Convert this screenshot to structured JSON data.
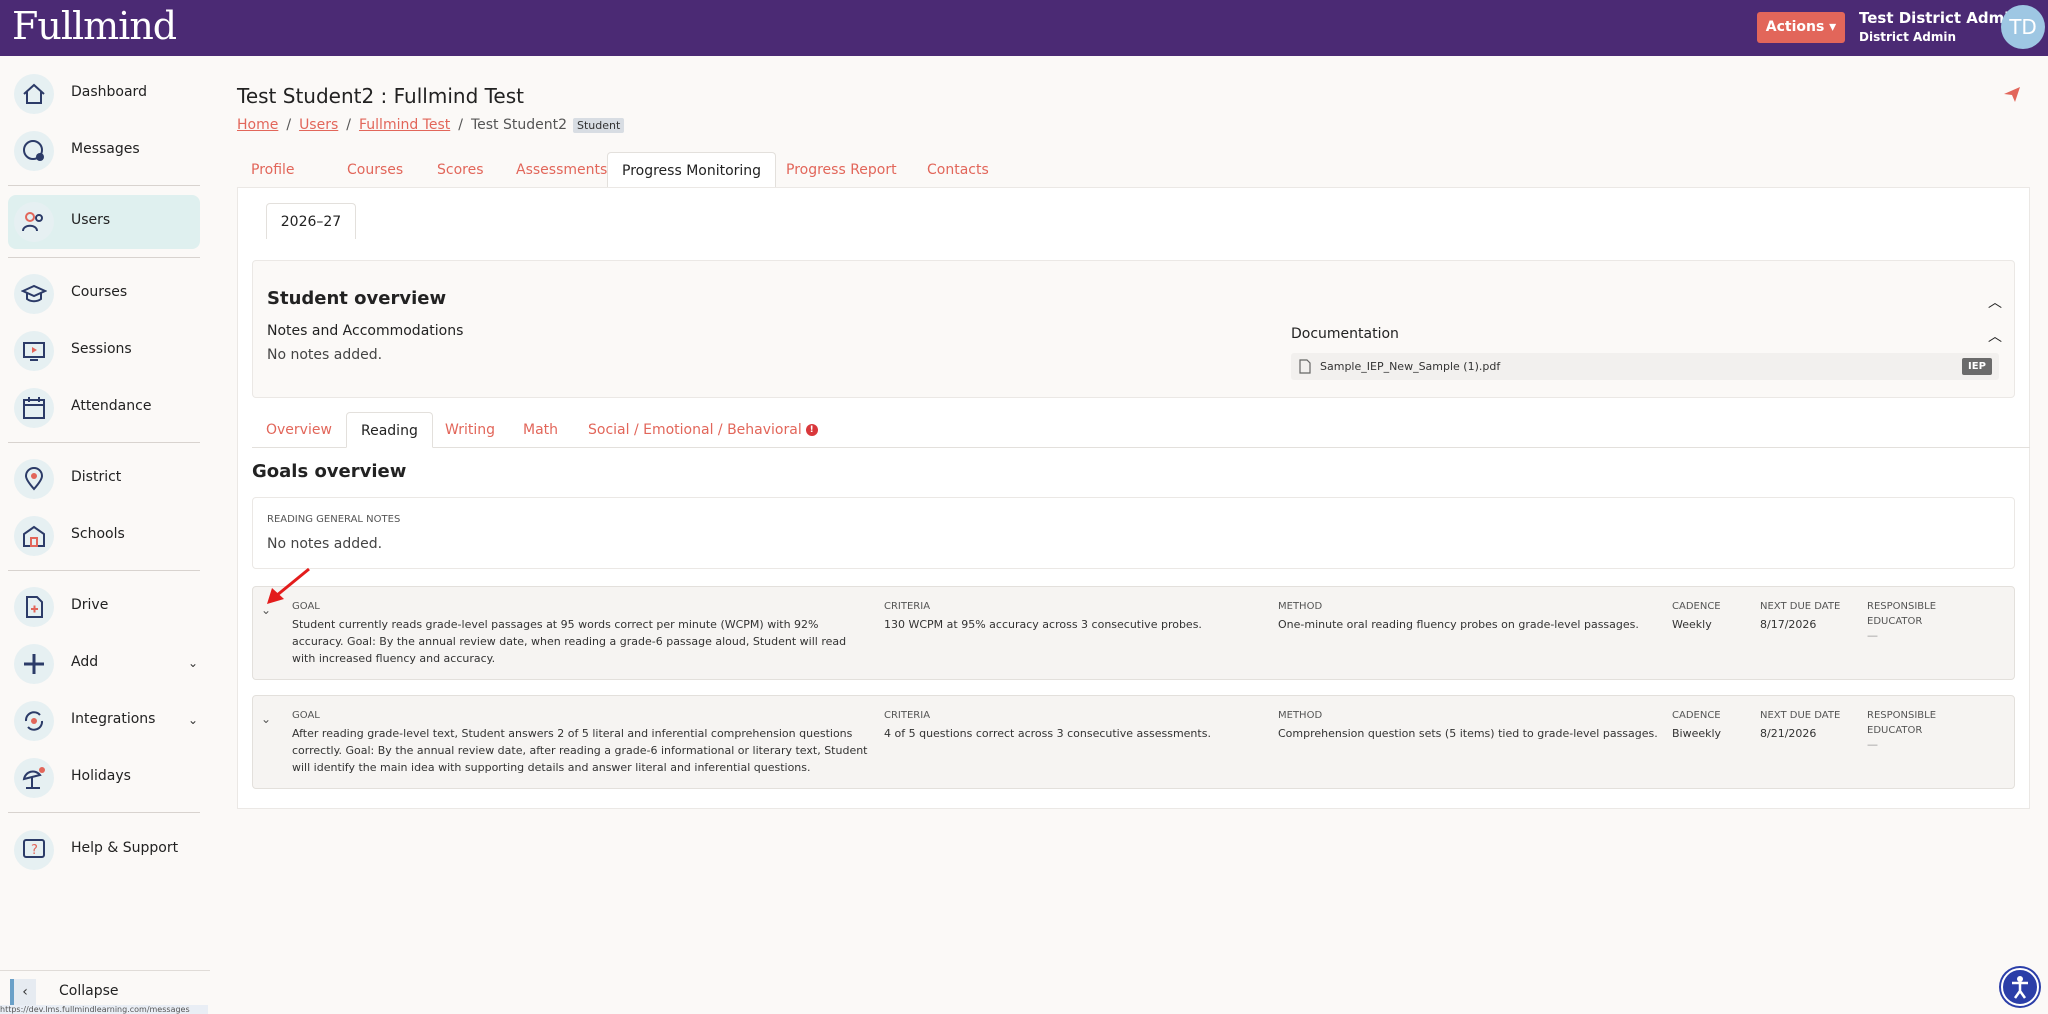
{
  "header": {
    "logo": "Fullmind",
    "actions_label": "Actions ▾",
    "user_name": "Test District Admin",
    "user_role": "District Admin",
    "avatar_initials": "TD"
  },
  "sidebar": {
    "items": [
      {
        "label": "Dashboard",
        "icon": "home-icon"
      },
      {
        "label": "Messages",
        "icon": "messages-icon"
      },
      {
        "label": "Users",
        "icon": "users-icon"
      },
      {
        "label": "Courses",
        "icon": "courses-icon"
      },
      {
        "label": "Sessions",
        "icon": "sessions-icon"
      },
      {
        "label": "Attendance",
        "icon": "calendar-icon"
      },
      {
        "label": "District",
        "icon": "location-icon"
      },
      {
        "label": "Schools",
        "icon": "school-icon"
      },
      {
        "label": "Drive",
        "icon": "drive-icon"
      },
      {
        "label": "Add",
        "icon": "add-icon"
      },
      {
        "label": "Integrations",
        "icon": "integrations-icon"
      },
      {
        "label": "Holidays",
        "icon": "holidays-icon"
      },
      {
        "label": "Help & Support",
        "icon": "help-icon"
      }
    ],
    "collapse_label": "Collapse",
    "status_url": "https://dev.lms.fullmindlearning.com/messages"
  },
  "page": {
    "title": "Test Student2 : Fullmind Test",
    "breadcrumb": {
      "home": "Home",
      "users": "Users",
      "org": "Fullmind Test",
      "current": "Test Student2",
      "badge": "Student",
      "sep": "/"
    },
    "tabs": [
      "Profile",
      "Courses",
      "Scores",
      "Assessments",
      "Progress Monitoring",
      "Progress Report",
      "Contacts"
    ],
    "year": "2026–27"
  },
  "overview": {
    "title": "Student overview",
    "notes_label": "Notes and Accommodations",
    "notes_value": "No notes added.",
    "doc_label": "Documentation",
    "doc_file": "Sample_IEP_New_Sample (1).pdf",
    "doc_badge": "IEP"
  },
  "subtabs": [
    "Overview",
    "Reading",
    "Writing",
    "Math",
    "Social / Emotional / Behavioral"
  ],
  "alert_badge": "!",
  "goals": {
    "title": "Goals overview",
    "general_notes_label": "READING GENERAL NOTES",
    "general_notes_value": "No notes added.",
    "headers": {
      "goal": "GOAL",
      "criteria": "CRITERIA",
      "method": "METHOD",
      "cadence": "CADENCE",
      "next_due": "NEXT DUE DATE",
      "responsible": "RESPONSIBLE EDUCATOR"
    },
    "items": [
      {
        "goal": "Student currently reads grade-level passages at 95 words correct per minute (WCPM) with 92% accuracy. Goal: By the annual review date, when reading a grade-6 passage aloud, Student will read with increased fluency and accuracy.",
        "criteria": "130 WCPM at 95% accuracy across 3 consecutive probes.",
        "method": "One-minute oral reading fluency probes on grade-level passages.",
        "cadence": "Weekly",
        "next_due": "8/17/2026",
        "responsible": "—"
      },
      {
        "goal": "After reading grade-level text, Student answers 2 of 5 literal and inferential comprehension questions correctly. Goal: By the annual review date, after reading a grade-6 informational or literary text, Student will identify the main idea with supporting details and answer literal and inferential questions.",
        "criteria": "4 of 5 questions correct across 3 consecutive assessments.",
        "method": "Comprehension question sets (5 items) tied to grade-level passages.",
        "cadence": "Biweekly",
        "next_due": "8/21/2026",
        "responsible": "—"
      }
    ]
  },
  "colors": {
    "brand_purple": "#4b2a74",
    "accent_coral": "#e2665a",
    "active_nav": "#dff0ef",
    "alert_red": "#d9373b"
  }
}
